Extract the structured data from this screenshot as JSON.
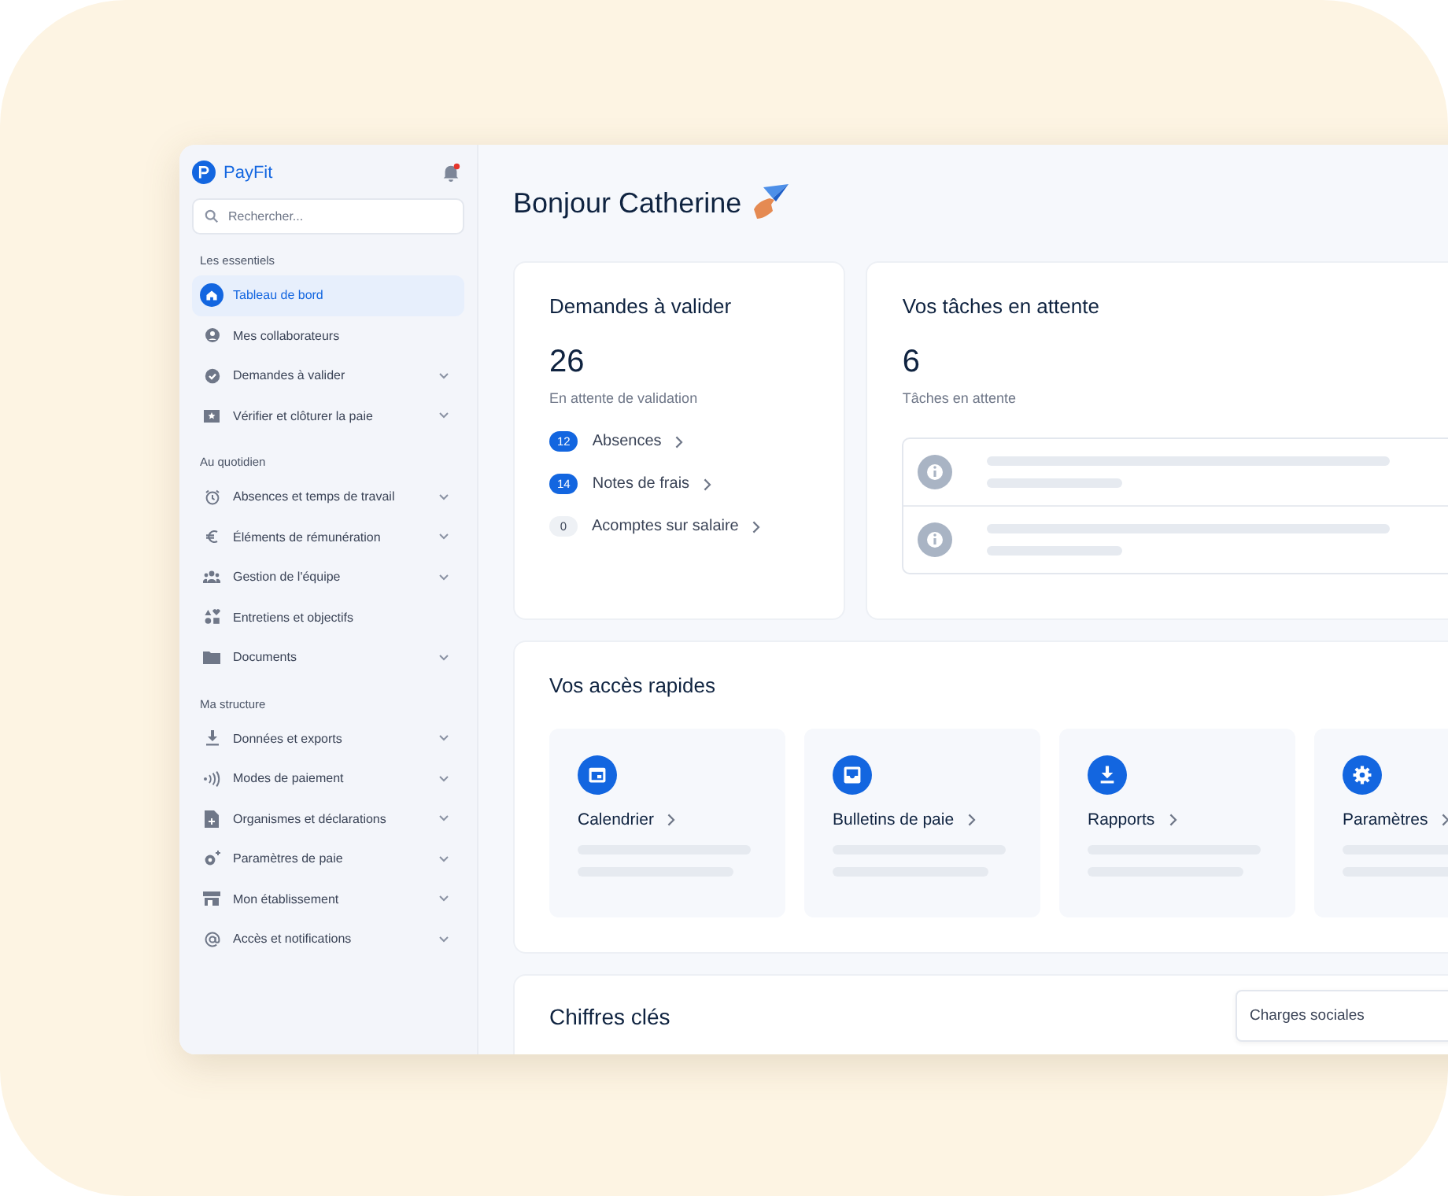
{
  "sidebar": {
    "brand": "PayFit",
    "notification_dot": true,
    "search": {
      "placeholder": "Rechercher..."
    },
    "sections": [
      {
        "title": "Les essentiels",
        "items": [
          {
            "label": "Tableau de bord",
            "selected": true,
            "expandable": false
          },
          {
            "label": "Mes collaborateurs",
            "selected": false,
            "expandable": false
          },
          {
            "label": "Demandes à valider",
            "selected": false,
            "expandable": true
          },
          {
            "label": "Vérifier et clôturer la paie",
            "selected": false,
            "expandable": true
          }
        ]
      },
      {
        "title": "Au quotidien",
        "items": [
          {
            "label": "Absences et temps de travail",
            "selected": false,
            "expandable": true
          },
          {
            "label": "Éléments de rémunération",
            "selected": false,
            "expandable": true
          },
          {
            "label": "Gestion de l'équipe",
            "selected": false,
            "expandable": true
          },
          {
            "label": "Entretiens et objectifs",
            "selected": false,
            "expandable": false
          },
          {
            "label": "Documents",
            "selected": false,
            "expandable": true
          }
        ]
      },
      {
        "title": "Ma structure",
        "items": [
          {
            "label": "Données et exports",
            "selected": false,
            "expandable": true
          },
          {
            "label": "Modes de paiement",
            "selected": false,
            "expandable": true
          },
          {
            "label": "Organismes et déclarations",
            "selected": false,
            "expandable": true
          },
          {
            "label": "Paramètres de paie",
            "selected": false,
            "expandable": true
          },
          {
            "label": "Mon établissement",
            "selected": false,
            "expandable": true
          },
          {
            "label": "Accès et notifications",
            "selected": false,
            "expandable": true
          }
        ]
      }
    ]
  },
  "greeting": "Bonjour Catherine",
  "requests_card": {
    "title": "Demandes à valider",
    "count": "26",
    "caption": "En attente de validation",
    "links": [
      {
        "count": "12",
        "label": "Absences",
        "highlighted": true
      },
      {
        "count": "14",
        "label": "Notes de frais",
        "highlighted": true
      },
      {
        "count": "0",
        "label": "Acomptes sur salaire",
        "highlighted": false
      }
    ]
  },
  "tasks_card": {
    "title": "Vos tâches en attente",
    "count": "6",
    "caption": "Tâches en attente"
  },
  "quick_access": {
    "title": "Vos accès rapides",
    "items": [
      {
        "label": "Calendrier"
      },
      {
        "label": "Bulletins de paie"
      },
      {
        "label": "Rapports"
      },
      {
        "label": "Paramètres"
      }
    ]
  },
  "key_figures": {
    "title": "Chiffres clés",
    "select": {
      "value": "Charges sociales"
    }
  }
}
